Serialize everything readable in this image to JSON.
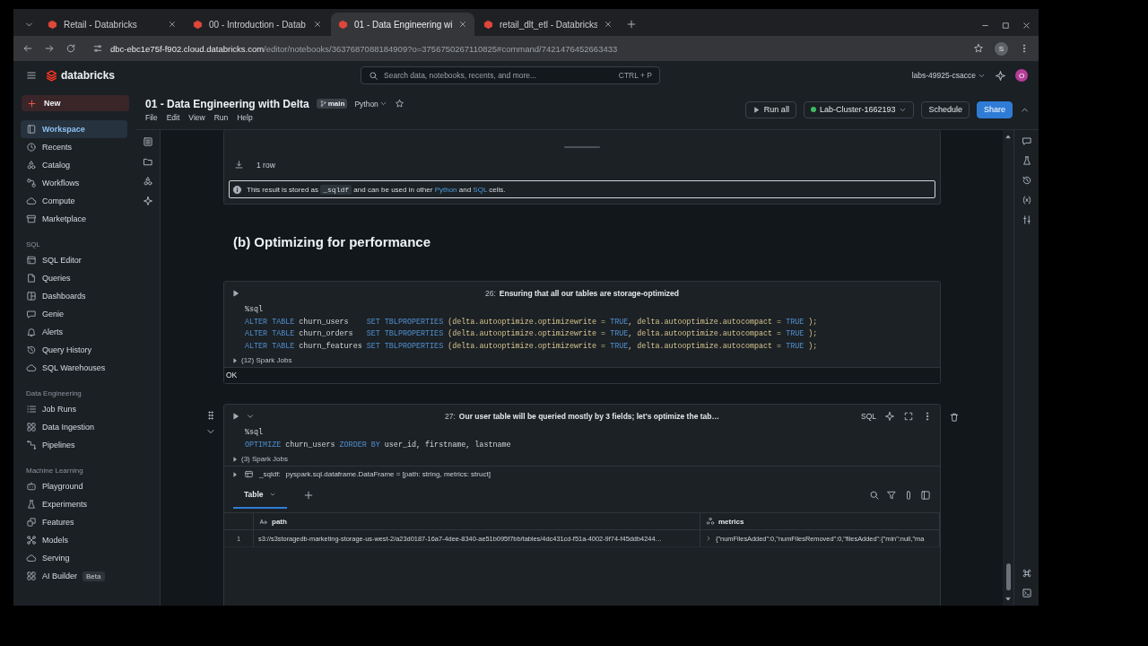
{
  "browser": {
    "tabs": [
      {
        "title": "Retail - Databricks",
        "selected": false
      },
      {
        "title": "00 - Introduction - Datab",
        "selected": false
      },
      {
        "title": "01 - Data Engineering wi",
        "selected": true
      },
      {
        "title": "retail_dlt_etl - Databricks",
        "selected": false
      }
    ],
    "url_host": "dbc-ebc1e75f-f902.cloud.databricks.com",
    "url_path": "/editor/notebooks/3637687088184909?o=3756750267110825#command/7421476452663433",
    "profile": "S"
  },
  "app": {
    "logo": "databricks",
    "search": {
      "placeholder": "Search data, notebooks, recents, and more...",
      "shortcut": "CTRL + P"
    },
    "workspace": "labs-49925-csacce",
    "avatar": "O"
  },
  "sidebar": {
    "new_button": "New",
    "sections": [
      {
        "items": [
          {
            "label": "Workspace",
            "selected": true
          },
          {
            "label": "Recents",
            "selected": false
          },
          {
            "label": "Catalog",
            "selected": false
          },
          {
            "label": "Workflows",
            "selected": false
          },
          {
            "label": "Compute",
            "selected": false
          },
          {
            "label": "Marketplace",
            "selected": false
          }
        ]
      },
      {
        "title": "SQL",
        "items": [
          {
            "label": "SQL Editor",
            "selected": false
          },
          {
            "label": "Queries",
            "selected": false
          },
          {
            "label": "Dashboards",
            "selected": false
          },
          {
            "label": "Genie",
            "selected": false
          },
          {
            "label": "Alerts",
            "selected": false
          },
          {
            "label": "Query History",
            "selected": false
          },
          {
            "label": "SQL Warehouses",
            "selected": false
          }
        ]
      },
      {
        "title": "Data Engineering",
        "items": [
          {
            "label": "Job Runs",
            "selected": false
          },
          {
            "label": "Data Ingestion",
            "selected": false
          },
          {
            "label": "Pipelines",
            "selected": false
          }
        ]
      },
      {
        "title": "Machine Learning",
        "items": [
          {
            "label": "Playground",
            "selected": false
          },
          {
            "label": "Experiments",
            "selected": false
          },
          {
            "label": "Features",
            "selected": false
          },
          {
            "label": "Models",
            "selected": false
          },
          {
            "label": "Serving",
            "selected": false
          },
          {
            "label": "AI Builder",
            "selected": false,
            "badge": "Beta"
          }
        ]
      }
    ]
  },
  "notebook": {
    "title": "01 - Data Engineering with Delta",
    "branch": "main",
    "language": "Python",
    "menu": [
      "File",
      "Edit",
      "View",
      "Run",
      "Help"
    ],
    "run_all": "Run all",
    "cluster": "Lab-Cluster-1662193",
    "schedule": "Schedule",
    "share": "Share"
  },
  "prev_output": {
    "row_count": "1 row",
    "info": [
      {
        "kind": "text",
        "text": "This result is stored as"
      },
      {
        "kind": "code",
        "text": "_sqldf"
      },
      {
        "kind": "text",
        "text": "and can be used in other"
      },
      {
        "kind": "link",
        "text": "Python"
      },
      {
        "kind": "text",
        "text": "and"
      },
      {
        "kind": "link",
        "text": "SQL"
      },
      {
        "kind": "text",
        "text": "cells."
      }
    ]
  },
  "heading": "(b) Optimizing for performance",
  "cells": [
    {
      "number": "26:",
      "title": "Ensuring that all our tables are storage-optimized",
      "focused": false,
      "code": [
        [
          {
            "kind": "plain",
            "text": "%sql"
          }
        ],
        [
          {
            "kind": "kw",
            "text": "ALTER TABLE"
          },
          {
            "kind": "plain",
            "text": " churn_users    "
          },
          {
            "kind": "kw",
            "text": "SET TBLPROPERTIES"
          },
          {
            "kind": "arg",
            "text": " (delta.autooptimize.optimizewrite = "
          },
          {
            "kind": "kw",
            "text": "TRUE"
          },
          {
            "kind": "arg",
            "text": ", delta.autooptimize.autocompact = "
          },
          {
            "kind": "kw",
            "text": "TRUE"
          },
          {
            "kind": "arg",
            "text": " );"
          }
        ],
        [
          {
            "kind": "kw",
            "text": "ALTER TABLE"
          },
          {
            "kind": "plain",
            "text": " churn_orders   "
          },
          {
            "kind": "kw",
            "text": "SET TBLPROPERTIES"
          },
          {
            "kind": "arg",
            "text": " (delta.autooptimize.optimizewrite = "
          },
          {
            "kind": "kw",
            "text": "TRUE"
          },
          {
            "kind": "arg",
            "text": ", delta.autooptimize.autocompact = "
          },
          {
            "kind": "kw",
            "text": "TRUE"
          },
          {
            "kind": "arg",
            "text": " );"
          }
        ],
        [
          {
            "kind": "kw",
            "text": "ALTER TABLE"
          },
          {
            "kind": "plain",
            "text": " churn_features "
          },
          {
            "kind": "kw",
            "text": "SET TBLPROPERTIES"
          },
          {
            "kind": "arg",
            "text": " (delta.autooptimize.optimizewrite = "
          },
          {
            "kind": "kw",
            "text": "TRUE"
          },
          {
            "kind": "arg",
            "text": ", delta.autooptimize.autocompact = "
          },
          {
            "kind": "kw",
            "text": "TRUE"
          },
          {
            "kind": "arg",
            "text": " );"
          }
        ]
      ],
      "jobs": "(12) Spark Jobs",
      "output": "OK"
    },
    {
      "number": "27:",
      "title": "Our user table will be queried mostly by 3 fields; let's optimize the tab…",
      "focused": true,
      "language": "SQL",
      "code": [
        [
          {
            "kind": "plain",
            "text": "%sql"
          }
        ],
        [
          {
            "kind": "kw",
            "text": "OPTIMIZE"
          },
          {
            "kind": "plain",
            "text": " churn_users "
          },
          {
            "kind": "kw",
            "text": "ZORDER BY"
          },
          {
            "kind": "plain",
            "text": " user_id, firstname, lastname"
          }
        ]
      ],
      "jobs": "(3) Spark Jobs",
      "dataframe": {
        "name": "_sqldf:",
        "schema": "pyspark.sql.dataframe.DataFrame = [path: string, metrics: struct]"
      },
      "result": {
        "tab": "Table",
        "columns": [
          "",
          "path",
          "metrics"
        ],
        "rows": [
          [
            "1",
            "s3://s3storagedb-marketing-storage-us-west-2/a23d0187-16a7-4dee-8340-ae51b095f7bb/tables/4dc431cd-f51a-4002-9f74-f45ddb4244…",
            "{\"numFilesAdded\":0,\"numFilesRemoved\":0,\"filesAdded\":{\"min\":null,\"ma"
          ]
        ]
      }
    }
  ]
}
